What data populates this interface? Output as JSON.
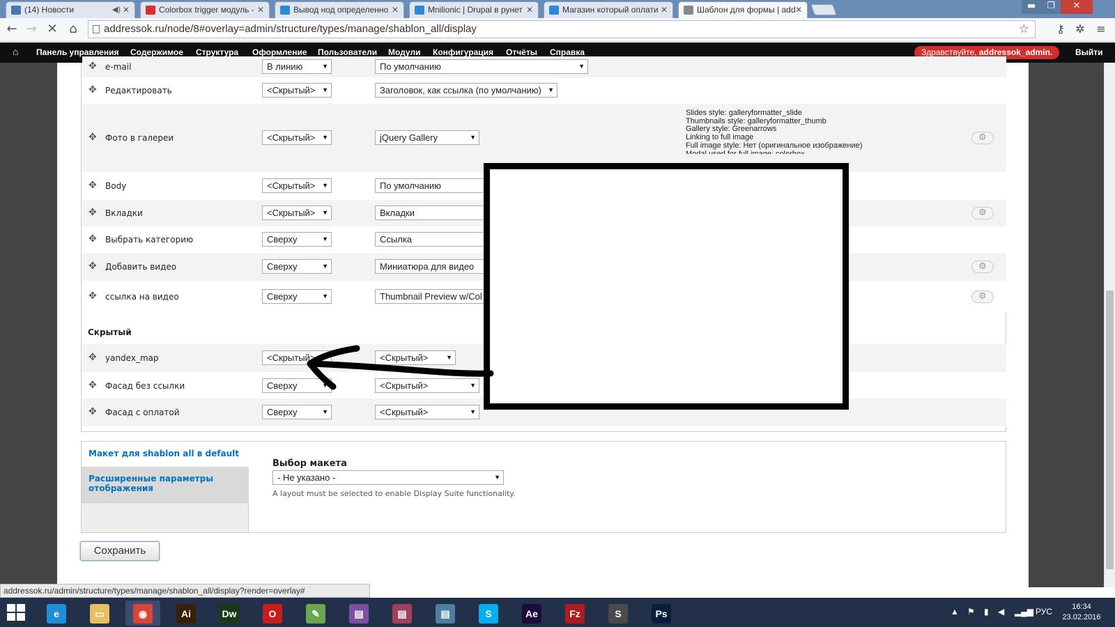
{
  "browser": {
    "tabs": [
      {
        "title": "(14) Новости",
        "icon": "vk-icon",
        "color": "#4a76a8",
        "muted": true
      },
      {
        "title": "Colorbox trigger модуль -",
        "icon": "yandex-icon",
        "color": "#d93025",
        "muted": false
      },
      {
        "title": "Вывод нод определенно",
        "icon": "drupal-ru-icon",
        "color": "#2b8ad6",
        "muted": false
      },
      {
        "title": "Mnilionic | Drupal в рунет",
        "icon": "drupal-ru-icon",
        "color": "#2b8ad6",
        "muted": false
      },
      {
        "title": "Магазин который оплати",
        "icon": "drupal-drop-icon",
        "color": "#2b8ad6",
        "muted": false
      },
      {
        "title": "Шаблон для формы | add",
        "icon": "loading-spinner-icon",
        "color": "#888888",
        "muted": false
      }
    ],
    "address": "addressok.ru/node/8#overlay=admin/structure/types/manage/shablon_all/display"
  },
  "adminbar": {
    "menu": [
      "Панель управления",
      "Содержимое",
      "Структура",
      "Оформление",
      "Пользователи",
      "Модули",
      "Конфигурация",
      "Отчёты",
      "Справка"
    ],
    "greeting_prefix": "Здравствуйте,",
    "greeting_user": "addressok_admin.",
    "logout": "Выйти"
  },
  "fields": [
    {
      "name": "e-mail",
      "region": "В линию",
      "format": "По умолчанию",
      "gear": false,
      "shade": "odd"
    },
    {
      "name": "Редактировать",
      "region": "<Скрытый>",
      "format": "Заголовок, как ссылка (по умолчанию)",
      "gear": false,
      "shade": "even"
    },
    {
      "name": "Фото в галереи",
      "region": "<Скрытый>",
      "format": "jQuery Gallery",
      "gear": true,
      "shade": "odd",
      "summary": [
        "Slides style: galleryformatter_slide",
        "Thumbnails style: galleryformatter_thumb",
        "Gallery style: Greenarrows",
        "Linking to full image",
        "Full image style: Нет (оригинальное изображение)",
        "Modal used for full image: colorbox"
      ]
    },
    {
      "name": "Body",
      "region": "<Скрытый>",
      "format": "По умолчанию",
      "gear": false,
      "shade": "even"
    },
    {
      "name": "Вкладки",
      "region": "<Скрытый>",
      "format": "Вкладки",
      "gear": true,
      "shade": "odd"
    },
    {
      "name": "Выбрать категорию",
      "region": "Сверху",
      "format": "Ссылка",
      "gear": false,
      "shade": "even"
    },
    {
      "name": "Добавить видео",
      "region": "Сверху",
      "format": "Миниатюра для видео",
      "gear": true,
      "shade": "odd"
    },
    {
      "name": "ссылка на видео",
      "region": "Сверху",
      "format": "Thumbnail Preview w/Col",
      "gear": true,
      "shade": "even"
    }
  ],
  "hidden_region": {
    "label": "Скрытый",
    "fields": [
      {
        "name": "yandex_map",
        "region": "<Скрытый>",
        "format": "<Скрытый>",
        "shade": "odd"
      },
      {
        "name": "Фасад без ссылки",
        "region": "Сверху",
        "format": "<Скрытый>",
        "shade": "even"
      },
      {
        "name": "Фасад с оплатой",
        "region": "Сверху",
        "format": "<Скрытый>",
        "shade": "odd"
      }
    ]
  },
  "vertical_tabs": {
    "tabs": [
      "Макет для shablon all в default",
      "Расширенные параметры отображения"
    ],
    "layout_label": "Выбор макета",
    "layout_value": "- Не указано -",
    "layout_desc": "A layout must be selected to enable Display Suite functionality."
  },
  "save_label": "Сохранить",
  "status_url": "addressok.ru/admin/structure/types/manage/shablon_all/display?render=overlay#",
  "taskbar": {
    "apps": [
      {
        "name": "ie-icon",
        "label": "e",
        "bg": "#1e8fd6"
      },
      {
        "name": "explorer-icon",
        "label": "▭",
        "bg": "#e8c060"
      },
      {
        "name": "chrome-icon",
        "label": "◉",
        "bg": "#db4437"
      },
      {
        "name": "illustrator-icon",
        "label": "Ai",
        "bg": "#3b1e08"
      },
      {
        "name": "dreamweaver-icon",
        "label": "Dw",
        "bg": "#1a3a16"
      },
      {
        "name": "opera-icon",
        "label": "O",
        "bg": "#cc1b1b"
      },
      {
        "name": "notepad-icon",
        "label": "✎",
        "bg": "#6aa84f"
      },
      {
        "name": "winrar-icon",
        "label": "▤",
        "bg": "#7d4fa3"
      },
      {
        "name": "winrar2-icon",
        "label": "▤",
        "bg": "#a33f5a"
      },
      {
        "name": "winrar3-icon",
        "label": "▤",
        "bg": "#4f7da3"
      },
      {
        "name": "skype-icon",
        "label": "S",
        "bg": "#00aff0"
      },
      {
        "name": "after-effects-icon",
        "label": "Ae",
        "bg": "#1f0a3c"
      },
      {
        "name": "filezilla-icon",
        "label": "Fz",
        "bg": "#b01c1c"
      },
      {
        "name": "sublime-icon",
        "label": "S",
        "bg": "#4a4a4a"
      },
      {
        "name": "photoshop-icon",
        "label": "Ps",
        "bg": "#0b1d38"
      }
    ],
    "lang": "РУС",
    "time": "16:34",
    "date": "23.02.2016"
  }
}
